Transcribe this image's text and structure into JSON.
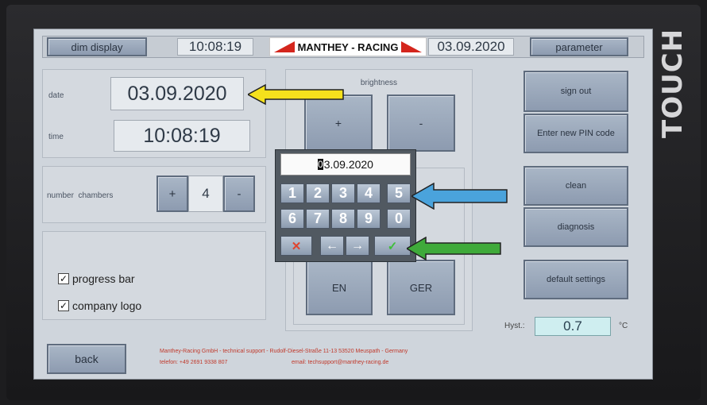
{
  "header": {
    "dim_display": "dim display",
    "time": "10:08:19",
    "logo_text": "MANTHEY - RACING",
    "date": "03.09.2020",
    "parameter": "parameter"
  },
  "datetime": {
    "date_label": "date",
    "date_value": "03.09.2020",
    "time_label": "time",
    "time_value": "10:08:19"
  },
  "chambers": {
    "label": "number  chambers",
    "plus": "+",
    "value": "4",
    "minus": "-"
  },
  "options": {
    "progress_bar": "progress bar",
    "company_logo": "company logo",
    "check": "✓"
  },
  "brightness": {
    "label": "brightness",
    "plus": "+",
    "minus": "-"
  },
  "language": {
    "en": "EN",
    "ger": "GER"
  },
  "right_buttons": {
    "sign_out": "sign out",
    "new_pin": "Enter new PIN code",
    "clean": "clean",
    "diagnosis": "diagnosis",
    "default_settings": "default settings"
  },
  "hyst": {
    "label": "Hyst.:",
    "value": "0.7",
    "unit": "°C"
  },
  "back": "back",
  "footer": {
    "line1": "Manthey-Racing GmbH - technical support - Rudolf-Diesel-Straße 11-13 53520 Meuspath - Germany",
    "line2a": "telefon: +49 2691 9338 807",
    "line2b": "email: techsupport@manthey-racing.de"
  },
  "keypad": {
    "display_first": "0",
    "display_rest": "3.09.2020",
    "row1": [
      "1",
      "2",
      "3",
      "4",
      "5"
    ],
    "row2": [
      "6",
      "7",
      "8",
      "9",
      "0"
    ],
    "cancel": "✕",
    "left": "←",
    "right": "→",
    "ok": "✓"
  },
  "overlay": {
    "touch": "TOUCH"
  },
  "colors": {
    "arrow_yellow": "#f5e11c",
    "arrow_blue": "#4aa3dc",
    "arrow_green": "#3faa3a",
    "keypad_cancel": "#e0442e",
    "keypad_ok": "#3fbf3a",
    "logo_red": "#d4261d"
  }
}
